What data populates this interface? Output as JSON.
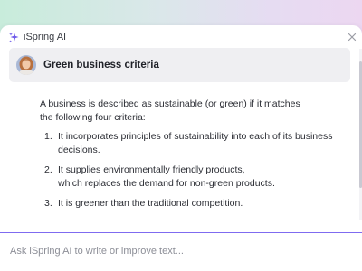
{
  "window": {
    "title": "iSpring AI"
  },
  "header": {
    "title": "Green business criteria"
  },
  "response": {
    "intro_lines": [
      "A business is described as sustainable (or green) if it matches",
      "the following four criteria:"
    ],
    "items": [
      {
        "number": "1.",
        "lines": [
          "It incorporates principles of sustainability into each of its business",
          "decisions."
        ]
      },
      {
        "number": "2.",
        "lines": [
          "It supplies environmentally friendly products,",
          "which replaces the demand for non-green products."
        ]
      },
      {
        "number": "3.",
        "lines": [
          "It is greener than the traditional competition."
        ]
      }
    ]
  },
  "input": {
    "placeholder": "Ask iSpring AI to write or improve text..."
  },
  "icons": {
    "title": "sparkle-icon",
    "close": "close-icon",
    "avatar": "avatar"
  },
  "colors": {
    "accent": "#7f6bf0",
    "header_bg": "#efeff2",
    "text": "#2a2c33"
  }
}
